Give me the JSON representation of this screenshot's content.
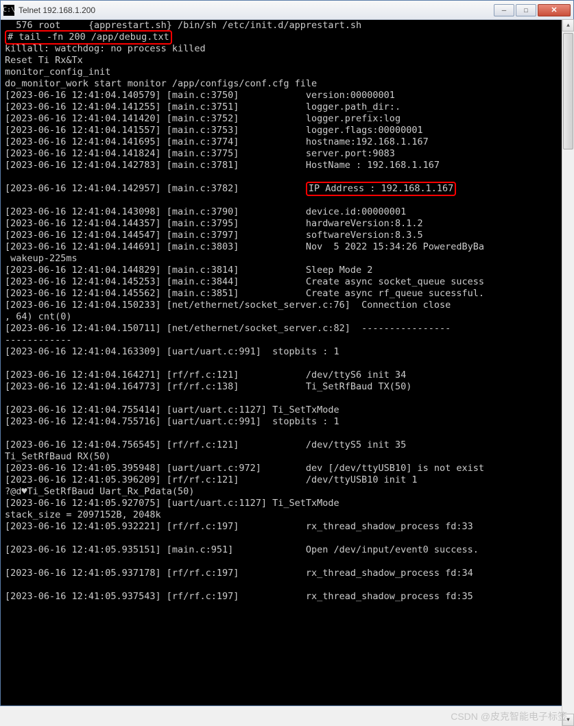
{
  "window": {
    "title": "Telnet 192.168.1.200",
    "icon_label": "C:\\"
  },
  "terminal": {
    "ps_line": "  576 root     {apprestart.sh} /bin/sh /etc/init.d/apprestart.sh",
    "cmd": "# tail -fn 200 /app/debug.txt",
    "pre_lines": [
      "killall: watchdog: no process killed",
      "Reset Ti Rx&Tx",
      "monitor_config_init",
      "do_monitor_work start monitor /app/configs/conf.cfg file"
    ],
    "log1": [
      {
        "ts": "[2023-06-16 12:41:04.140579]",
        "src": "[main.c:3750]",
        "msg": "version:00000001"
      },
      {
        "ts": "[2023-06-16 12:41:04.141255]",
        "src": "[main.c:3751]",
        "msg": "logger.path_dir:."
      },
      {
        "ts": "[2023-06-16 12:41:04.141420]",
        "src": "[main.c:3752]",
        "msg": "logger.prefix:log"
      },
      {
        "ts": "[2023-06-16 12:41:04.141557]",
        "src": "[main.c:3753]",
        "msg": "logger.flags:00000001"
      },
      {
        "ts": "[2023-06-16 12:41:04.141695]",
        "src": "[main.c:3774]",
        "msg": "hostname:192.168.1.167"
      },
      {
        "ts": "[2023-06-16 12:41:04.141824]",
        "src": "[main.c:3775]",
        "msg": "server.port:9083"
      },
      {
        "ts": "[2023-06-16 12:41:04.142783]",
        "src": "[main.c:3781]",
        "msg": "HostName : 192.168.1.167"
      }
    ],
    "ip_line": {
      "ts": "[2023-06-16 12:41:04.142957]",
      "src": "[main.c:3782]",
      "msg": "IP Address : 192.168.1.167"
    },
    "log2": [
      {
        "ts": "[2023-06-16 12:41:04.143098]",
        "src": "[main.c:3790]",
        "msg": "device.id:00000001"
      },
      {
        "ts": "[2023-06-16 12:41:04.144357]",
        "src": "[main.c:3795]",
        "msg": "hardwareVersion:8.1.2"
      },
      {
        "ts": "[2023-06-16 12:41:04.144547]",
        "src": "[main.c:3797]",
        "msg": "softwareVersion:8.3.5"
      },
      {
        "ts": "[2023-06-16 12:41:04.144691]",
        "src": "[main.c:3803]",
        "msg": "Nov  5 2022 15:34:26 PoweredByBa"
      }
    ],
    "wakeup": " wakeup-225ms",
    "log3": [
      {
        "ts": "[2023-06-16 12:41:04.144829]",
        "src": "[main.c:3814]",
        "msg": "Sleep Mode 2"
      },
      {
        "ts": "[2023-06-16 12:41:04.145253]",
        "src": "[main.c:3844]",
        "msg": "Create async socket_queue sucess"
      },
      {
        "ts": "[2023-06-16 12:41:04.145562]",
        "src": "[main.c:3851]",
        "msg": "Create async rf_queue sucessful."
      }
    ],
    "socket1": "[2023-06-16 12:41:04.150233] [net/ethernet/socket_server.c:76]  Connection close",
    "socket1b": ", 64) cnt(0)",
    "socket2": "[2023-06-16 12:41:04.150711] [net/ethernet/socket_server.c:82]  ----------------",
    "socket2b": "------------",
    "log4": [
      {
        "ts": "[2023-06-16 12:41:04.163309]",
        "src": "[uart/uart.c:991]",
        "msg": "stopbits : 1"
      }
    ],
    "log5": [
      {
        "ts": "[2023-06-16 12:41:04.164271]",
        "src": "[rf/rf.c:121]",
        "msg": "/dev/ttyS6 init 34"
      },
      {
        "ts": "[2023-06-16 12:41:04.164773]",
        "src": "[rf/rf.c:138]",
        "msg": "Ti_SetRfBaud TX(50)"
      }
    ],
    "log6": [
      {
        "ts": "[2023-06-16 12:41:04.755414]",
        "src": "[uart/uart.c:1127]",
        "msg": "Ti_SetTxMode"
      },
      {
        "ts": "[2023-06-16 12:41:04.755716]",
        "src": "[uart/uart.c:991]",
        "msg": "stopbits : 1"
      }
    ],
    "log7": [
      {
        "ts": "[2023-06-16 12:41:04.756545]",
        "src": "[rf/rf.c:121]",
        "msg": "/dev/ttyS5 init 35"
      }
    ],
    "rfbaud_rx": "Ti_SetRfBaud RX(50)",
    "log8": [
      {
        "ts": "[2023-06-16 12:41:05.395948]",
        "src": "[uart/uart.c:972]",
        "msg": "dev [/dev/ttyUSB10] is not exist"
      },
      {
        "ts": "[2023-06-16 12:41:05.396209]",
        "src": "[rf/rf.c:121]",
        "msg": "/dev/ttyUSB10 init 1"
      }
    ],
    "garble": "?@d♥Ti_SetRfBaud Uart_Rx_Pdata(50)",
    "log9": [
      {
        "ts": "[2023-06-16 12:41:05.927075]",
        "src": "[uart/uart.c:1127]",
        "msg": "Ti_SetTxMode"
      }
    ],
    "stack": "stack_size = 2097152B, 2048k",
    "log10": [
      {
        "ts": "[2023-06-16 12:41:05.932221]",
        "src": "[rf/rf.c:197]",
        "msg": "rx_thread_shadow_process fd:33"
      }
    ],
    "log11": [
      {
        "ts": "[2023-06-16 12:41:05.935151]",
        "src": "[main.c:951]",
        "msg": "Open /dev/input/event0 success."
      }
    ],
    "log12": [
      {
        "ts": "[2023-06-16 12:41:05.937178]",
        "src": "[rf/rf.c:197]",
        "msg": "rx_thread_shadow_process fd:34"
      }
    ],
    "log13": [
      {
        "ts": "[2023-06-16 12:41:05.937543]",
        "src": "[rf/rf.c:197]",
        "msg": "rx_thread_shadow_process fd:35"
      }
    ]
  },
  "watermark": "CSDN @皮克智能电子标签"
}
